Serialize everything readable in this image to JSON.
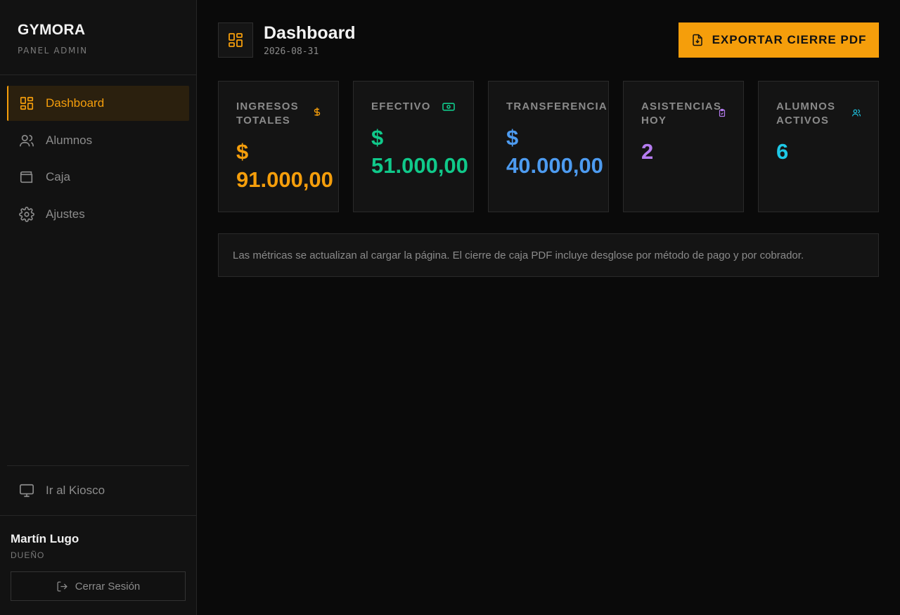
{
  "sidebar": {
    "brand": "GYMORA",
    "subtitle": "PANEL ADMIN",
    "items": [
      {
        "label": "Dashboard",
        "icon": "dashboard-icon",
        "active": true
      },
      {
        "label": "Alumnos",
        "icon": "users-icon"
      },
      {
        "label": "Caja",
        "icon": "wallet-icon"
      },
      {
        "label": "Ajustes",
        "icon": "gear-icon"
      }
    ],
    "kiosk_label": "Ir al Kiosco",
    "user": {
      "name": "Martín Lugo",
      "role": "DUEÑO"
    },
    "logout_label": "Cerrar Sesión"
  },
  "header": {
    "title": "Dashboard",
    "date": "2026-08-31",
    "export_label": "EXPORTAR CIERRE PDF"
  },
  "cards": [
    {
      "label": "INGRESOS TOTALES",
      "value": "$\n91.000,00",
      "icon": "dollar-icon",
      "color": "#f59e0b"
    },
    {
      "label": "EFECTIVO",
      "value": "$\n51.000,00",
      "icon": "banknote-icon",
      "color": "#10c98a"
    },
    {
      "label": "TRANSFERENCIA",
      "value": "$\n40.000,00",
      "icon": "",
      "color": "#4d9bf0"
    },
    {
      "label": "ASISTENCIAS HOY",
      "value": "2",
      "icon": "clipboard-check-icon",
      "color": "#b57cf0"
    },
    {
      "label": "ALUMNOS ACTIVOS",
      "value": "6",
      "icon": "users-icon",
      "color": "#1ec8e6"
    }
  ],
  "info_text": "Las métricas se actualizan al cargar la página. El cierre de caja PDF incluye desglose por método de pago y por cobrador.",
  "colors": {
    "accent": "#f59e0b",
    "background": "#0a0a0a",
    "sidebar": "#121212"
  }
}
